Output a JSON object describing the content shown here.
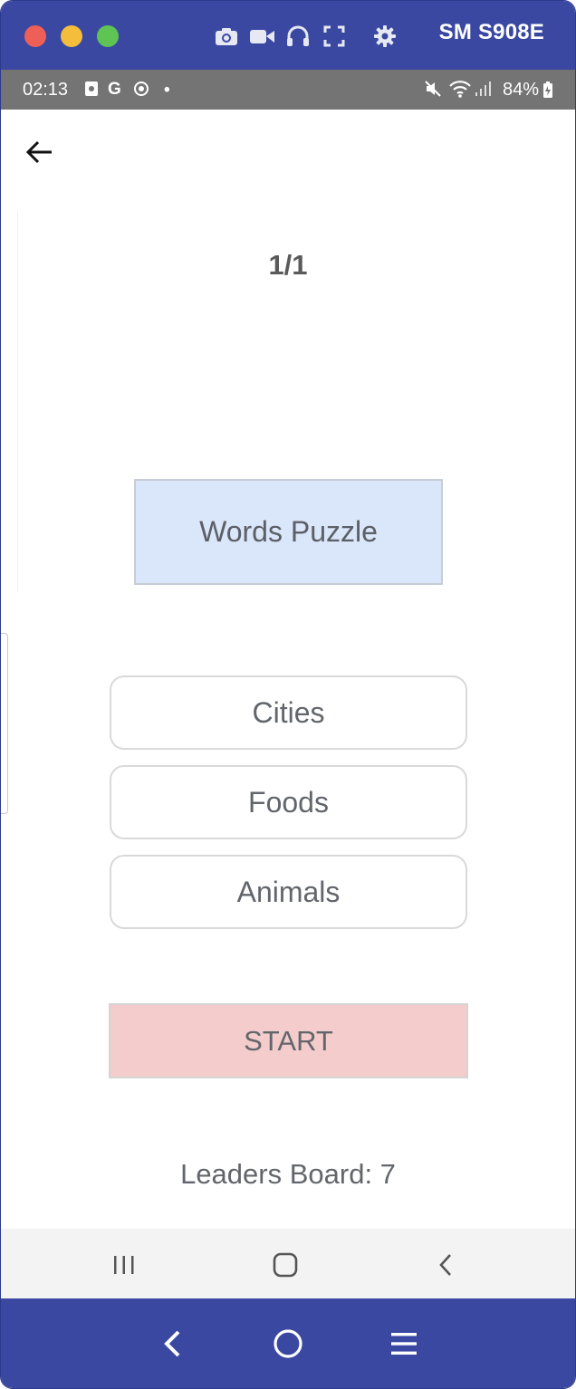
{
  "emulator": {
    "device_name": "SM S908E",
    "toolbar_icons": [
      "camera-icon",
      "video-icon",
      "headphones-icon",
      "fullscreen-icon",
      "settings-icon"
    ],
    "bottom_icons": [
      "back-icon",
      "home-icon",
      "menu-icon"
    ]
  },
  "status_bar": {
    "time": "02:13",
    "left_icons": [
      "screen-record-icon",
      "google-icon",
      "location-target-icon",
      "dot-icon"
    ],
    "battery": "84%",
    "right_icons": [
      "mute-icon",
      "wifi-icon",
      "signal-icon",
      "battery-charging-icon"
    ]
  },
  "app": {
    "progress": "1/1",
    "title": "Words Puzzle",
    "categories": [
      {
        "label": "Cities"
      },
      {
        "label": "Foods"
      },
      {
        "label": "Animals"
      }
    ],
    "start_label": "START",
    "leaders_board": "Leaders Board: 7"
  },
  "android_nav": [
    "recents-icon",
    "home-icon",
    "back-icon"
  ],
  "colors": {
    "emulator_bar": "#3a48a2",
    "status_bar": "#747474",
    "title_box_bg": "#dae6f9",
    "start_bg": "#f3cccb",
    "nav_bar": "#f3f3f3"
  }
}
